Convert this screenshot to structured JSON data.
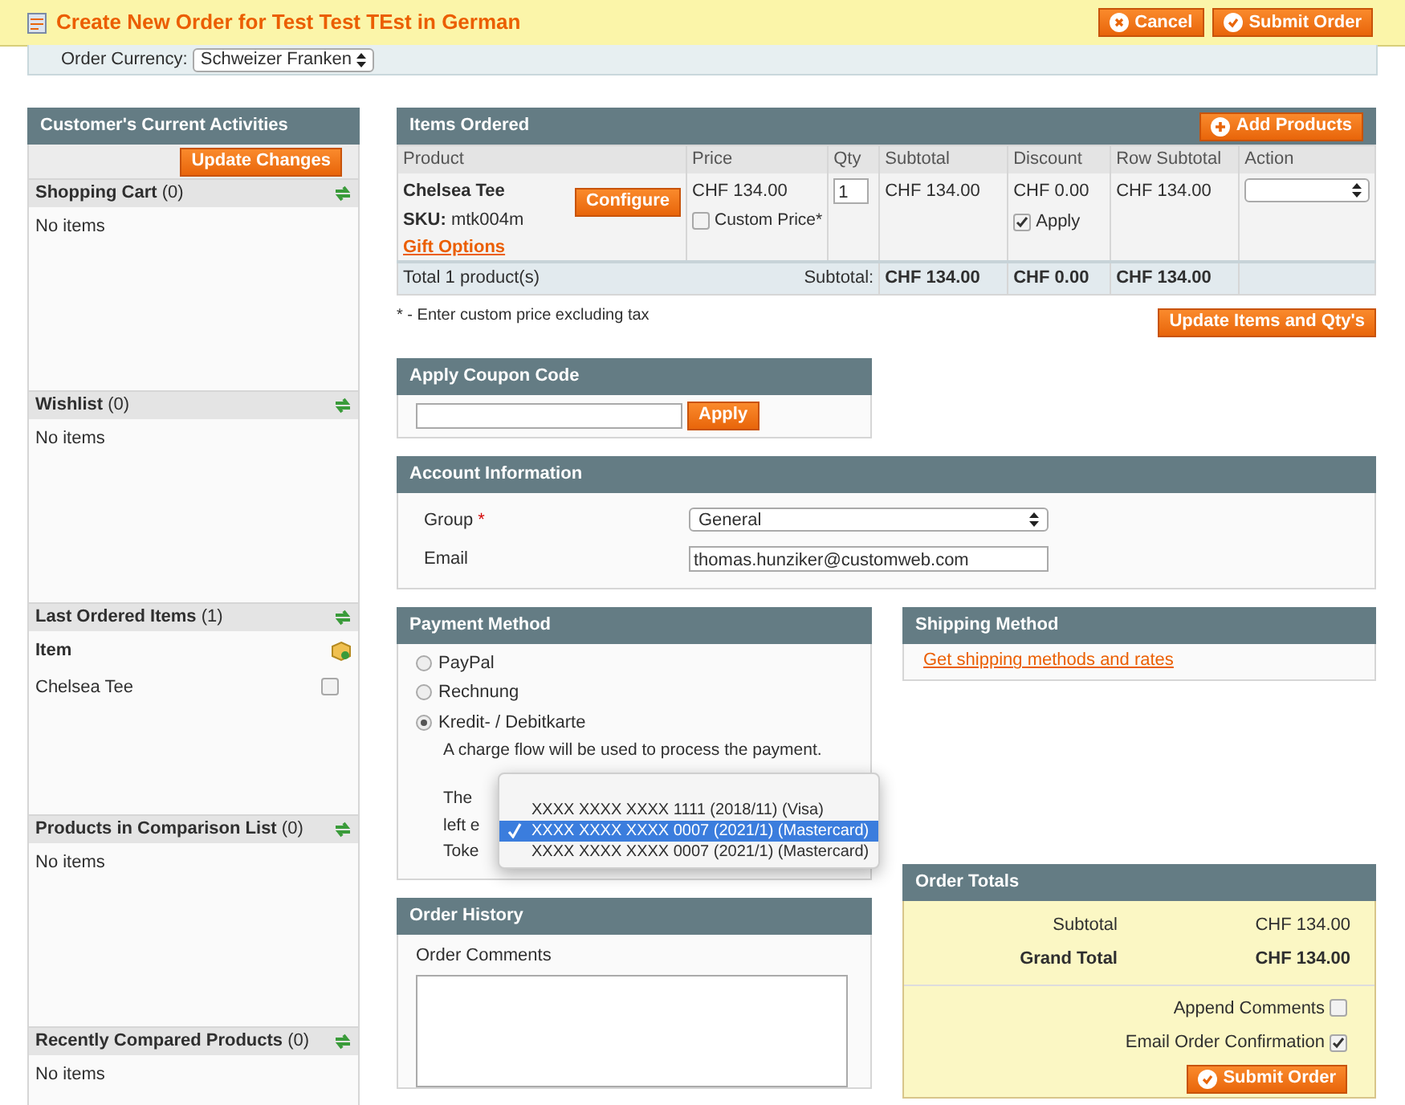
{
  "page_title": "Create New Order for Test Test TEst in German",
  "header_buttons": [
    {
      "label": "Cancel",
      "kind": "cancel"
    },
    {
      "label": "Submit Order",
      "kind": "submit"
    }
  ],
  "currency": {
    "label": "Order Currency:",
    "value": "Schweizer Franken"
  },
  "sidebar": {
    "title": "Customer's Current Activities",
    "update_button": "Update Changes",
    "sections": [
      {
        "title": "Shopping Cart",
        "count": "(0)",
        "kind": "empty",
        "text": "No items"
      },
      {
        "title": "Wishlist",
        "count": "(0)",
        "kind": "empty",
        "text": "No items"
      },
      {
        "title": "Last Ordered Items",
        "count": "(1)",
        "kind": "items",
        "column": "Item",
        "items": [
          {
            "name": "Chelsea Tee",
            "checked": false
          }
        ]
      },
      {
        "title": "Products in Comparison List",
        "count": "(0)",
        "kind": "empty",
        "text": "No items"
      },
      {
        "title": "Recently Compared Products",
        "count": "(0)",
        "kind": "empty",
        "text": "No items"
      }
    ]
  },
  "items_ordered": {
    "title": "Items Ordered",
    "add_button": "Add Products",
    "columns": [
      "Product",
      "Price",
      "Qty",
      "Subtotal",
      "Discount",
      "Row Subtotal",
      "Action"
    ],
    "rows": [
      {
        "product": "Chelsea Tee",
        "sku_label": "SKU:",
        "sku": "mtk004m",
        "configure": "Configure",
        "gift": "Gift Options",
        "price": "CHF 134.00",
        "custom_price": {
          "label": "Custom Price*",
          "checked": false
        },
        "qty": "1",
        "subtotal": "CHF 134.00",
        "discount": "CHF 0.00",
        "apply": {
          "label": "Apply",
          "checked": true
        },
        "row_subtotal": "CHF 134.00"
      }
    ],
    "total_label": "Total 1 product(s)",
    "subtotal_label": "Subtotal:",
    "totals": [
      "CHF 134.00",
      "CHF 0.00",
      "CHF 134.00"
    ],
    "note": "* - Enter custom price excluding tax",
    "update_button": "Update Items and Qty's"
  },
  "coupon": {
    "title": "Apply Coupon Code",
    "button": "Apply"
  },
  "account": {
    "title": "Account Information",
    "fields": [
      {
        "label": "Group",
        "required_mark": "*",
        "kind": "select",
        "value": "General"
      },
      {
        "label": "Email",
        "kind": "text",
        "value": "thomas.hunziker@customweb.com"
      }
    ]
  },
  "payment": {
    "title": "Payment Method",
    "methods": [
      {
        "label": "PayPal",
        "selected": false
      },
      {
        "label": "Rechnung",
        "selected": false
      },
      {
        "label": "Kredit- / Debitkarte",
        "selected": true
      }
    ],
    "description": "A charge flow will be used to process the payment.",
    "partial_lines": [
      "The",
      "left e",
      "Toke"
    ],
    "dropdown": [
      {
        "label": "XXXX XXXX XXXX 1111 (2018/11) (Visa)",
        "selected": false
      },
      {
        "label": "XXXX XXXX XXXX 0007 (2021/1) (Mastercard)",
        "selected": true
      },
      {
        "label": "XXXX XXXX XXXX 0007 (2021/1) (Mastercard)",
        "selected": false
      }
    ]
  },
  "shipping": {
    "title": "Shipping Method",
    "link": "Get shipping methods and rates"
  },
  "history": {
    "title": "Order History",
    "label": "Order Comments"
  },
  "totals": {
    "title": "Order Totals",
    "rows": [
      {
        "label": "Subtotal",
        "value": "CHF 134.00",
        "bold": false
      },
      {
        "label": "Grand Total",
        "value": "CHF 134.00",
        "bold": true
      }
    ],
    "options": [
      {
        "label": "Append Comments",
        "checked": false
      },
      {
        "label": "Email Order Confirmation",
        "checked": true
      }
    ],
    "submit": "Submit Order"
  }
}
